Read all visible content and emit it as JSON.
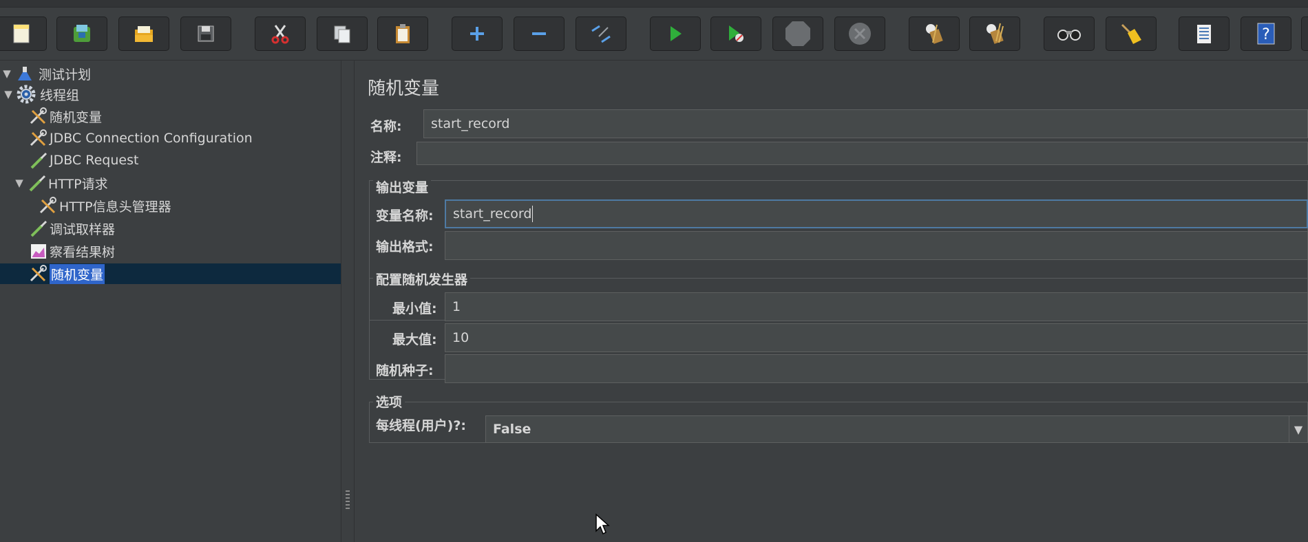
{
  "toolbar": {
    "buttons": [
      {
        "name": "new-icon"
      },
      {
        "name": "templates-icon"
      },
      {
        "name": "open-icon"
      },
      {
        "name": "save-icon"
      },
      {
        "name": "cut-icon"
      },
      {
        "name": "copy-icon"
      },
      {
        "name": "paste-icon"
      },
      {
        "name": "expand-icon"
      },
      {
        "name": "collapse-icon"
      },
      {
        "name": "toggle-icon"
      },
      {
        "name": "start-icon"
      },
      {
        "name": "start-no-pauses-icon"
      },
      {
        "name": "stop-icon"
      },
      {
        "name": "shutdown-icon"
      },
      {
        "name": "clear-icon"
      },
      {
        "name": "clear-all-icon"
      },
      {
        "name": "search-icon"
      },
      {
        "name": "reset-search-icon"
      },
      {
        "name": "function-helper-icon"
      },
      {
        "name": "help-icon"
      }
    ]
  },
  "tree": {
    "items": [
      {
        "label": "测试计划",
        "icon": "flask-icon"
      },
      {
        "label": "线程组",
        "icon": "gear-icon"
      },
      {
        "label": "随机变量",
        "icon": "tools-icon"
      },
      {
        "label": "JDBC Connection Configuration",
        "icon": "tools-icon"
      },
      {
        "label": "JDBC Request",
        "icon": "pipette-icon"
      },
      {
        "label": "HTTP请求",
        "icon": "pipette-icon"
      },
      {
        "label": "HTTP信息头管理器",
        "icon": "tools-icon"
      },
      {
        "label": "调试取样器",
        "icon": "pipette-icon"
      },
      {
        "label": "察看结果树",
        "icon": "chart-icon"
      },
      {
        "label": "随机变量",
        "icon": "tools-icon"
      }
    ]
  },
  "panel": {
    "title": "随机变量",
    "name_label": "名称:",
    "name_value": "start_record",
    "comment_label": "注释:",
    "comment_value": "",
    "output_group": "输出变量",
    "var_name_label": "变量名称:",
    "var_name_value": "start_record",
    "format_label": "输出格式:",
    "format_value": "",
    "generator_group": "配置随机发生器",
    "min_label": "最小值:",
    "min_value": "1",
    "max_label": "最大值:",
    "max_value": "10",
    "seed_label": "随机种子:",
    "seed_value": "",
    "options_group": "选项",
    "per_thread_label": "每线程(用户)?:",
    "per_thread_value": "False"
  }
}
